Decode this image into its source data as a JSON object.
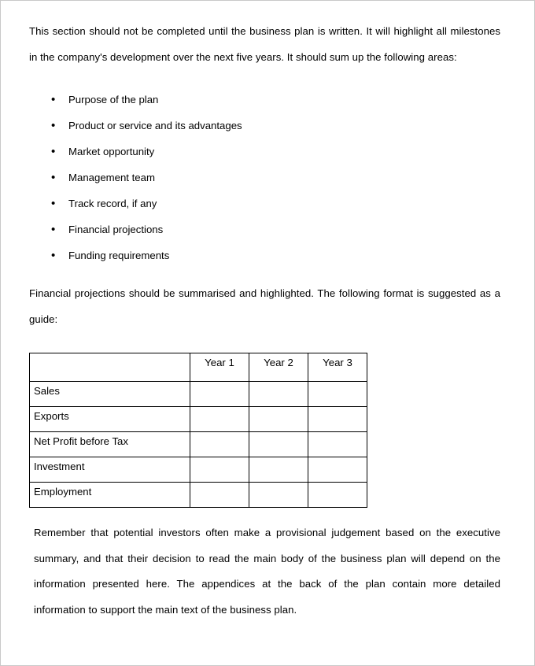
{
  "document": {
    "intro_paragraph": "This section should not be completed until the business plan is written.  It will highlight all milestones in the company's development over the next five years.  It should sum up the following areas:",
    "bullets": [
      {
        "marker": "•",
        "text": "Purpose of the plan"
      },
      {
        "marker": "•",
        "text": "Product or service and its advantages"
      },
      {
        "marker": "•",
        "text": "Market opportunity"
      },
      {
        "marker": "•",
        "text": "Management team"
      },
      {
        "marker": "•",
        "text": "Track record, if any"
      },
      {
        "marker": "•",
        "text": "Financial projections"
      },
      {
        "marker": "•",
        "text": "Funding requirements"
      }
    ],
    "mid_paragraph": "Financial projections should be summarised and highlighted.  The following format is suggested as a guide:",
    "closing_paragraph": "Remember that potential investors often make a provisional judgement based on the executive summary, and that their decision to read the main body of the business plan will depend on the information presented here.  The appendices at the back of the plan contain more detailed information to support the main text of the business plan.",
    "table": {
      "corner_header": "",
      "column_headers": [
        "Year 1",
        "Year 2",
        "Year 3"
      ],
      "rows": [
        {
          "label": "Sales",
          "values": [
            "",
            "",
            ""
          ]
        },
        {
          "label": "Exports",
          "values": [
            "",
            "",
            ""
          ]
        },
        {
          "label": "Net Profit before Tax",
          "values": [
            "",
            "",
            ""
          ]
        },
        {
          "label": "Investment",
          "values": [
            "",
            "",
            ""
          ]
        },
        {
          "label": "Employment",
          "values": [
            "",
            "",
            ""
          ]
        }
      ]
    }
  },
  "colors": {
    "text": "#000000",
    "page_background": "#ffffff",
    "page_border": "#c9c9c9",
    "table_border": "#000000"
  }
}
